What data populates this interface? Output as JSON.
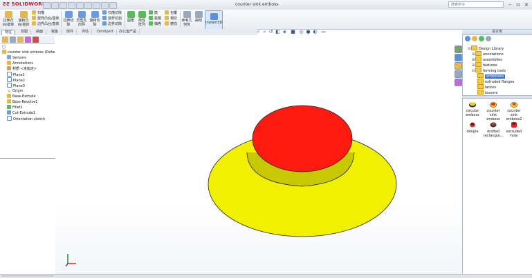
{
  "titlebar": {
    "app_name": "SOLIDWORKS",
    "doc_title": "counter sink emboss",
    "search_placeholder": "搜索命令"
  },
  "ribbon": {
    "big_buttons": [
      {
        "label": "拉伸凸台/基体"
      },
      {
        "label": "旋转凸台/基体"
      },
      {
        "label": "拉伸切除"
      },
      {
        "label": "异型孔向导"
      },
      {
        "label": "旋转切除"
      },
      {
        "label": "圆角"
      },
      {
        "label": "线性阵列"
      },
      {
        "label": "参考几何体"
      },
      {
        "label": "曲线"
      },
      {
        "label": "Instant3D"
      }
    ],
    "small_items": [
      {
        "label": "扫描"
      },
      {
        "label": "放样凸台/基体"
      },
      {
        "label": "边界凸台/基体"
      },
      {
        "label": "扫描切除"
      },
      {
        "label": "放样切割"
      },
      {
        "label": "边界切除"
      },
      {
        "label": "筋"
      },
      {
        "label": "拔模"
      },
      {
        "label": "抽壳"
      },
      {
        "label": "包覆"
      },
      {
        "label": "相交"
      },
      {
        "label": "镜向"
      }
    ]
  },
  "tabs": [
    "特征",
    "草图",
    "曲面",
    "钣金",
    "焊件",
    "评估",
    "DimXpert",
    "办公室产品"
  ],
  "feature_tree": {
    "root": "counter sink emboss  (Defaul",
    "items": [
      "Sensors",
      "Annotations",
      "材质 <未指定>",
      "Plane1",
      "Plane2",
      "Plane3",
      "Origin",
      "Base-Extrude",
      "Boss-Revolve1",
      "Fillet1",
      "Cut-Extrude1",
      "Orientation sketch"
    ]
  },
  "design_library": {
    "header": "设计库",
    "root": "Design Library",
    "folders": [
      "annotations",
      "assemblies",
      "features",
      "forming tools"
    ],
    "subfolders": [
      "embosses",
      "extruded flanges",
      "lances",
      "louvers"
    ],
    "selected": "embosses",
    "thumbnails": [
      {
        "label1": "circular",
        "label2": "emboss",
        "color": "#f1d21a"
      },
      {
        "label1": "counter sink",
        "label2": "emboss",
        "color": "#e0322b"
      },
      {
        "label1": "counter sink",
        "label2": "emboss2",
        "color": "#f1d21a"
      },
      {
        "label1": "dimple",
        "label2": "",
        "color": "#d23a2f"
      },
      {
        "label1": "drafted",
        "label2": "rectangul...",
        "color": "#3a3a3a"
      },
      {
        "label1": "extruded",
        "label2": "hole",
        "color": "#d8252a"
      }
    ]
  },
  "model": {
    "base_color": "#f0f000",
    "top_color": "#ff1a10"
  }
}
